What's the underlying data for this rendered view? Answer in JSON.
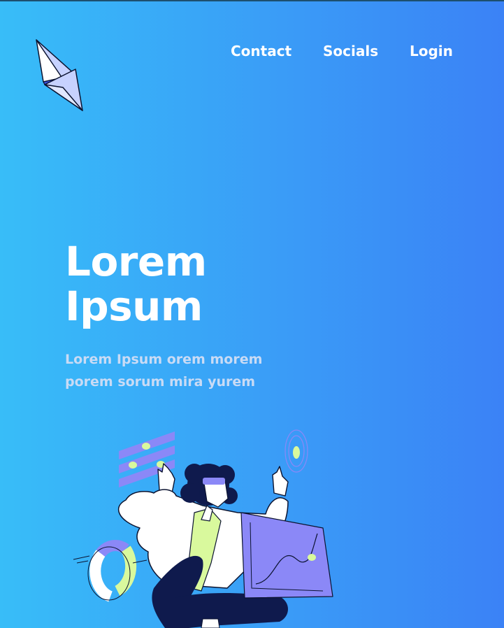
{
  "nav": {
    "items": [
      {
        "label": "Contact"
      },
      {
        "label": "Socials"
      },
      {
        "label": "Login"
      }
    ]
  },
  "hero": {
    "title_line1": "Lorem",
    "title_line2": "Ipsum",
    "subtitle": "Lorem Ipsum orem morem porem sorum mira yurem"
  },
  "icons": {
    "logo": "ethereum-diamond-icon"
  },
  "colors": {
    "gradient_start": "#38bdf8",
    "gradient_end": "#3b82f6",
    "accent_purple": "#8b88f7",
    "accent_lime": "#d9f99d",
    "navy": "#0f1a4d"
  }
}
